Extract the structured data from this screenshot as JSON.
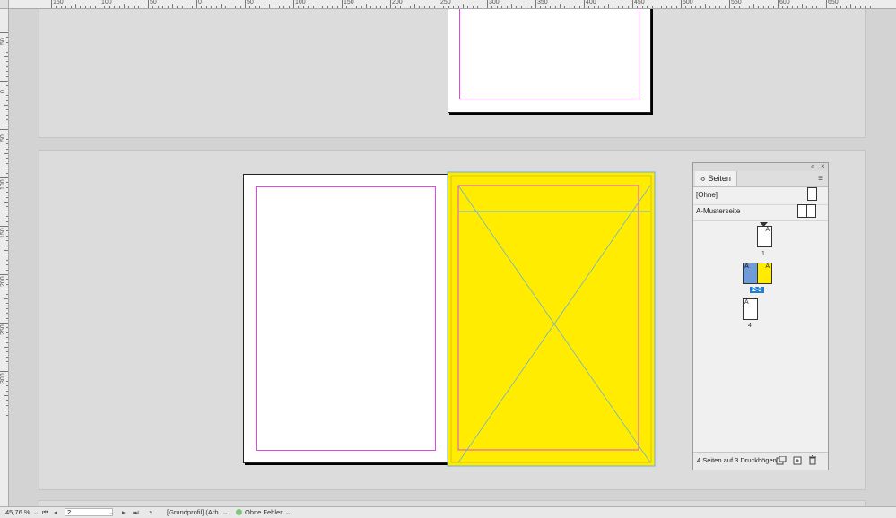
{
  "ruler": {
    "h_labels": [
      "150",
      "100",
      "50",
      "0",
      "50",
      "100",
      "150",
      "200",
      "250",
      "300",
      "350",
      "400",
      "450",
      "500",
      "550",
      "600",
      "650"
    ],
    "v_labels": [
      "50",
      "0",
      "50",
      "100",
      "150",
      "200",
      "250",
      "300"
    ]
  },
  "pages_panel": {
    "tab_label": "Seiten",
    "tab_icon": "expand-collapse-icon",
    "masters": [
      {
        "label": "[Ohne]"
      },
      {
        "label": "A-Musterseite"
      }
    ],
    "pages": [
      {
        "number": "1",
        "master": "A"
      },
      {
        "number": "2-3",
        "master_left": "A",
        "master_right": "A",
        "selected": true
      },
      {
        "number": "4",
        "master": "A"
      }
    ],
    "footer_text": "4 Seiten auf 3 Druckbögen",
    "footer_icons": [
      "page-size-icon",
      "new-page-icon",
      "trash-icon"
    ]
  },
  "statusbar": {
    "zoom": "45,76 %",
    "page_value": "2",
    "profile": "[Grundprofil] (Arb...",
    "preflight": "Ohne Fehler"
  },
  "colors": {
    "frame_fill": "#ffec00",
    "margin_guide": "#e048e0",
    "frame_edge": "#6ab0d8",
    "selected_page": "#1f7fd4"
  }
}
